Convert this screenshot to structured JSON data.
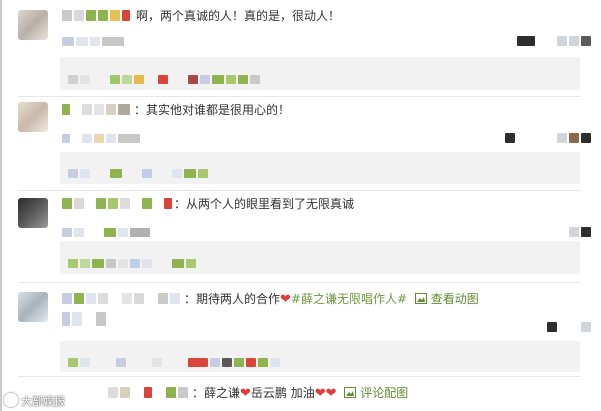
{
  "comments": [
    {
      "text": "啊，两个真诚的人！真的是，很动人！"
    },
    {
      "text": "：其实他对谁都是很用心的！"
    },
    {
      "text": "：从两个人的眼里看到了无限真诚"
    },
    {
      "text_prefix": "：期待两人的合作",
      "hashtag": "#薛之谦无限唱作人#",
      "link_label": "查看动图",
      "heart": "❤"
    },
    {
      "text_prefix": "：薛之谦",
      "text_mid": "岳云鹏 加油",
      "hearts": "❤❤",
      "link_label": "评论配图",
      "heart": "❤"
    }
  ],
  "watermark": "大部娱报",
  "icons": {
    "image_link": "image-icon"
  },
  "colors": {
    "highlight_green": "#6e9a3a",
    "heart_red": "#e33b3b",
    "reply_bg": "#f2f2f2"
  }
}
